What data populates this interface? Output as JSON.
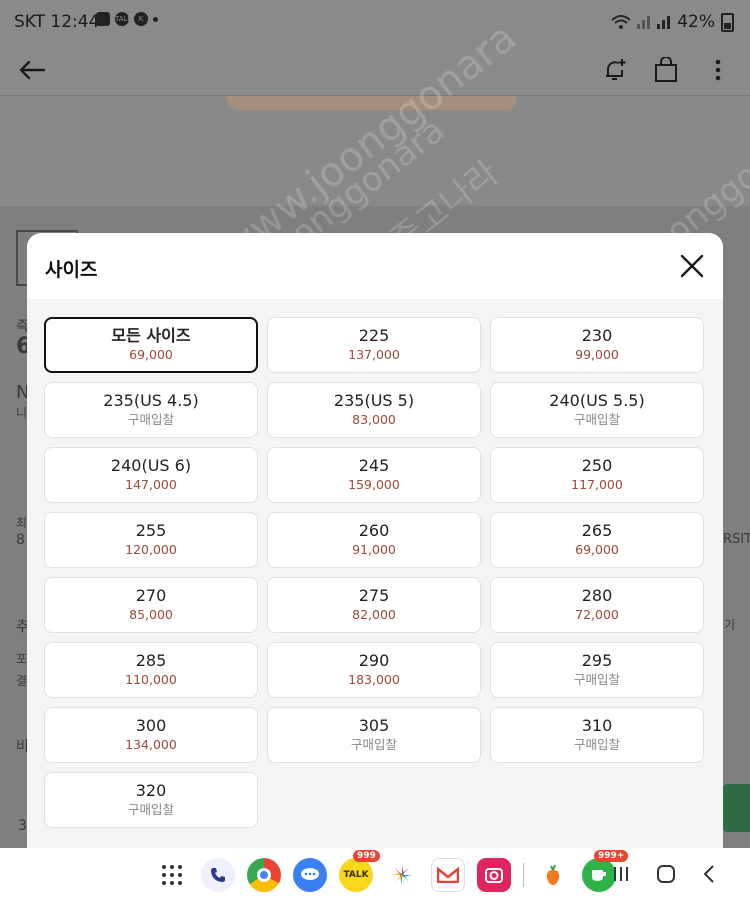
{
  "status_bar": {
    "carrier_time": "SKT 12:44",
    "talk_icon_text": "TALK",
    "k_icon_text": "K",
    "battery": "42%"
  },
  "background_ghost": {
    "price_initial": "6",
    "label_a": "즉",
    "label_n": "N",
    "label_b": "니",
    "label_c": "최",
    "label_d": "8",
    "label_e": "추",
    "label_f": "포",
    "label_g": "결",
    "label_h": "비",
    "label_i": "3",
    "right_rsit": "RSIT",
    "right_gi": "기"
  },
  "watermark": {
    "text1": "www.joonggonara",
    "text2": "naver.com/joonggonara",
    "text3": "/joonggon",
    "brand": "중고나라"
  },
  "modal": {
    "title": "사이즈",
    "sizes": [
      {
        "label": "모든 사이즈",
        "price": "69,000",
        "selected": true,
        "bid": false
      },
      {
        "label": "225",
        "price": "137,000",
        "bid": false
      },
      {
        "label": "230",
        "price": "99,000",
        "bid": false
      },
      {
        "label": "235(US 4.5)",
        "price": "구매입찰",
        "bid": true
      },
      {
        "label": "235(US 5)",
        "price": "83,000",
        "bid": false
      },
      {
        "label": "240(US 5.5)",
        "price": "구매입찰",
        "bid": true
      },
      {
        "label": "240(US 6)",
        "price": "147,000",
        "bid": false
      },
      {
        "label": "245",
        "price": "159,000",
        "bid": false
      },
      {
        "label": "250",
        "price": "117,000",
        "bid": false
      },
      {
        "label": "255",
        "price": "120,000",
        "bid": false
      },
      {
        "label": "260",
        "price": "91,000",
        "bid": false
      },
      {
        "label": "265",
        "price": "69,000",
        "bid": false
      },
      {
        "label": "270",
        "price": "85,000",
        "bid": false
      },
      {
        "label": "275",
        "price": "82,000",
        "bid": false
      },
      {
        "label": "280",
        "price": "72,000",
        "bid": false
      },
      {
        "label": "285",
        "price": "110,000",
        "bid": false
      },
      {
        "label": "290",
        "price": "183,000",
        "bid": false
      },
      {
        "label": "295",
        "price": "구매입찰",
        "bid": true
      },
      {
        "label": "300",
        "price": "134,000",
        "bid": false
      },
      {
        "label": "305",
        "price": "구매입찰",
        "bid": true
      },
      {
        "label": "310",
        "price": "구매입찰",
        "bid": true
      },
      {
        "label": "320",
        "price": "구매입찰",
        "bid": true
      }
    ]
  },
  "dock": {
    "talk_badge": "999",
    "talk_label": "TALK",
    "cafe_badge": "999+"
  },
  "colors": {
    "price_red": "#9a4a3a",
    "bid_gray": "#888888",
    "selected_border": "#111111",
    "dim_overlay": "#7f7f7f"
  }
}
